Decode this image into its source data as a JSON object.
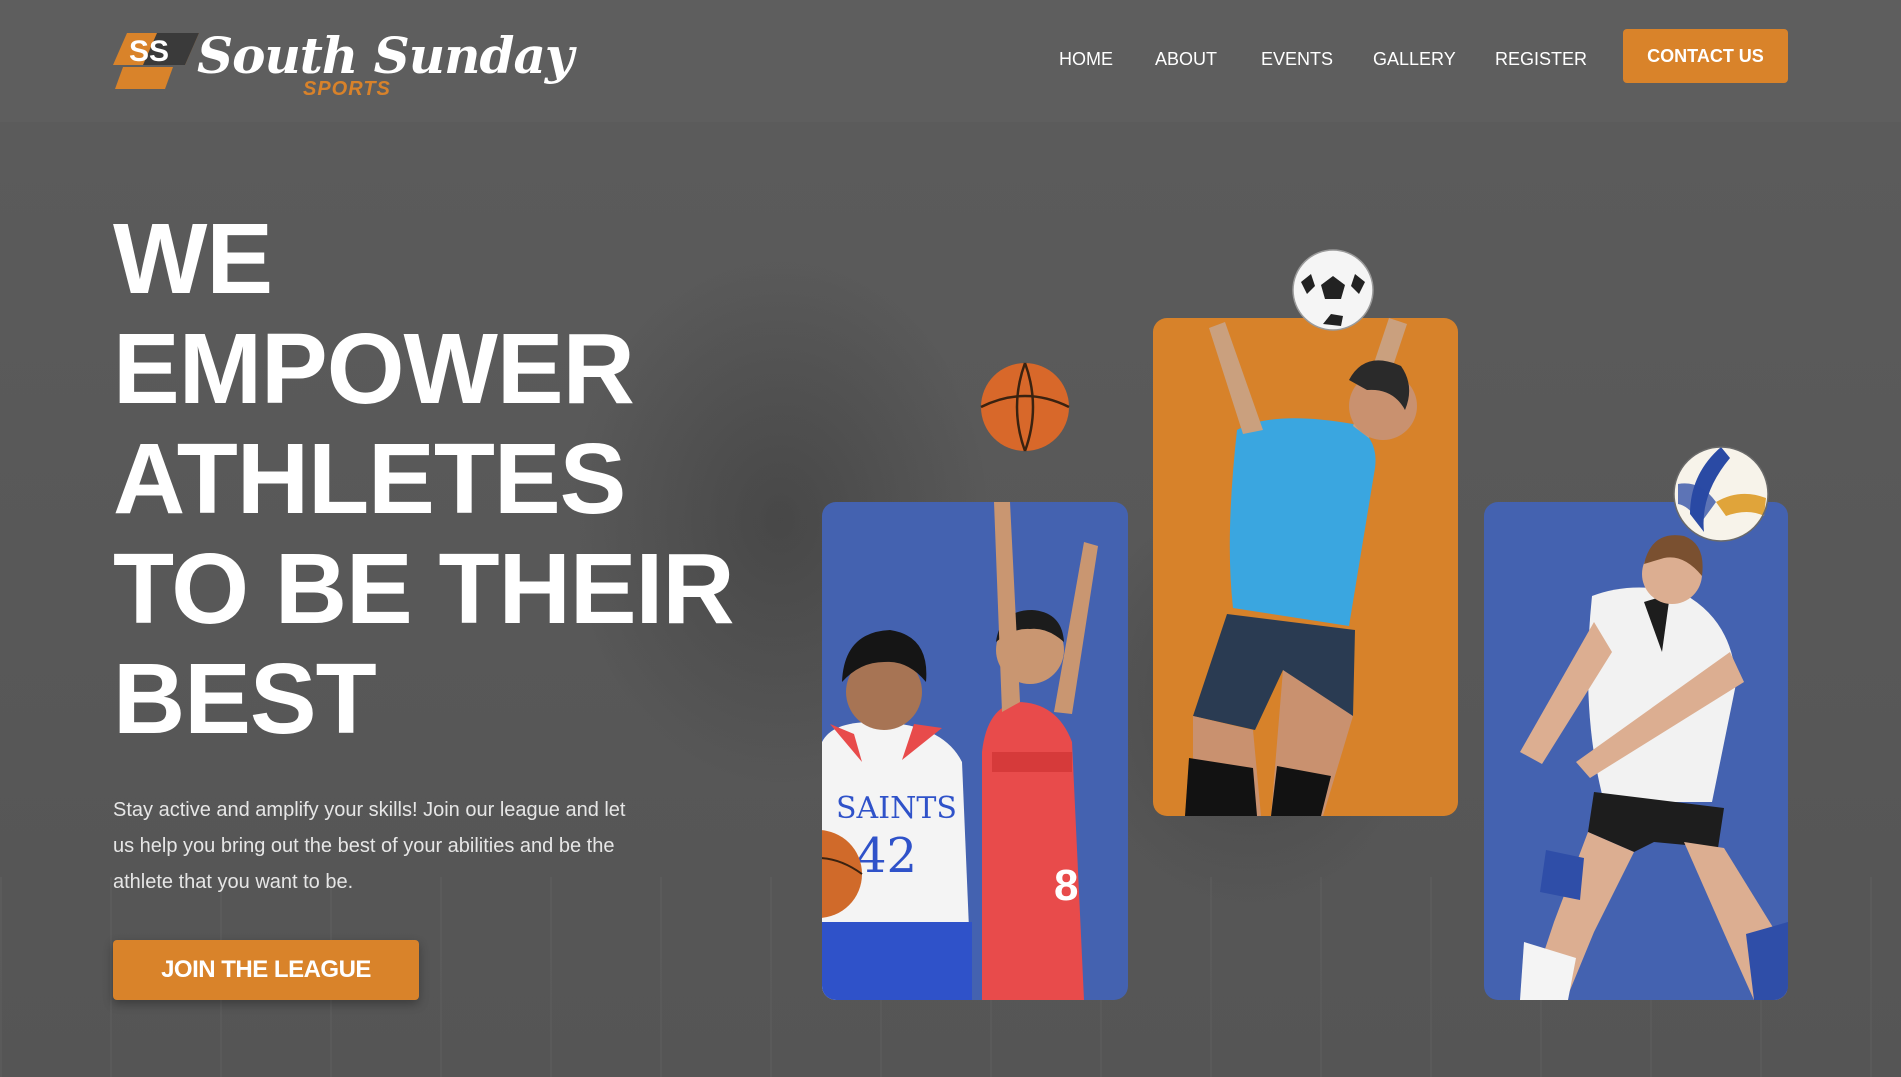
{
  "brand": {
    "mark": "SS",
    "name": "South Sunday",
    "tagline": "SPORTS",
    "accent": "#d9832a",
    "blue": "#4462b0"
  },
  "nav": {
    "items": [
      "HOME",
      "ABOUT",
      "EVENTS",
      "GALLERY",
      "REGISTER"
    ],
    "contact_label": "CONTACT US"
  },
  "hero": {
    "headline": [
      "WE",
      "EMPOWER",
      "ATHLETES",
      "TO BE THEIR",
      "BEST"
    ],
    "subtext": "Stay active and amplify your skills! Join our league and let us help you bring out the best of your abilities and be the athlete that you want to be.",
    "cta_label": "JOIN THE LEAGUE"
  },
  "cards": {
    "basketball": {
      "jersey_left_team": "SAINTS",
      "jersey_left_number": "42",
      "jersey_right_number": "8"
    }
  },
  "icons": [
    "basketball-icon",
    "soccer-ball-icon",
    "volleyball-icon"
  ]
}
